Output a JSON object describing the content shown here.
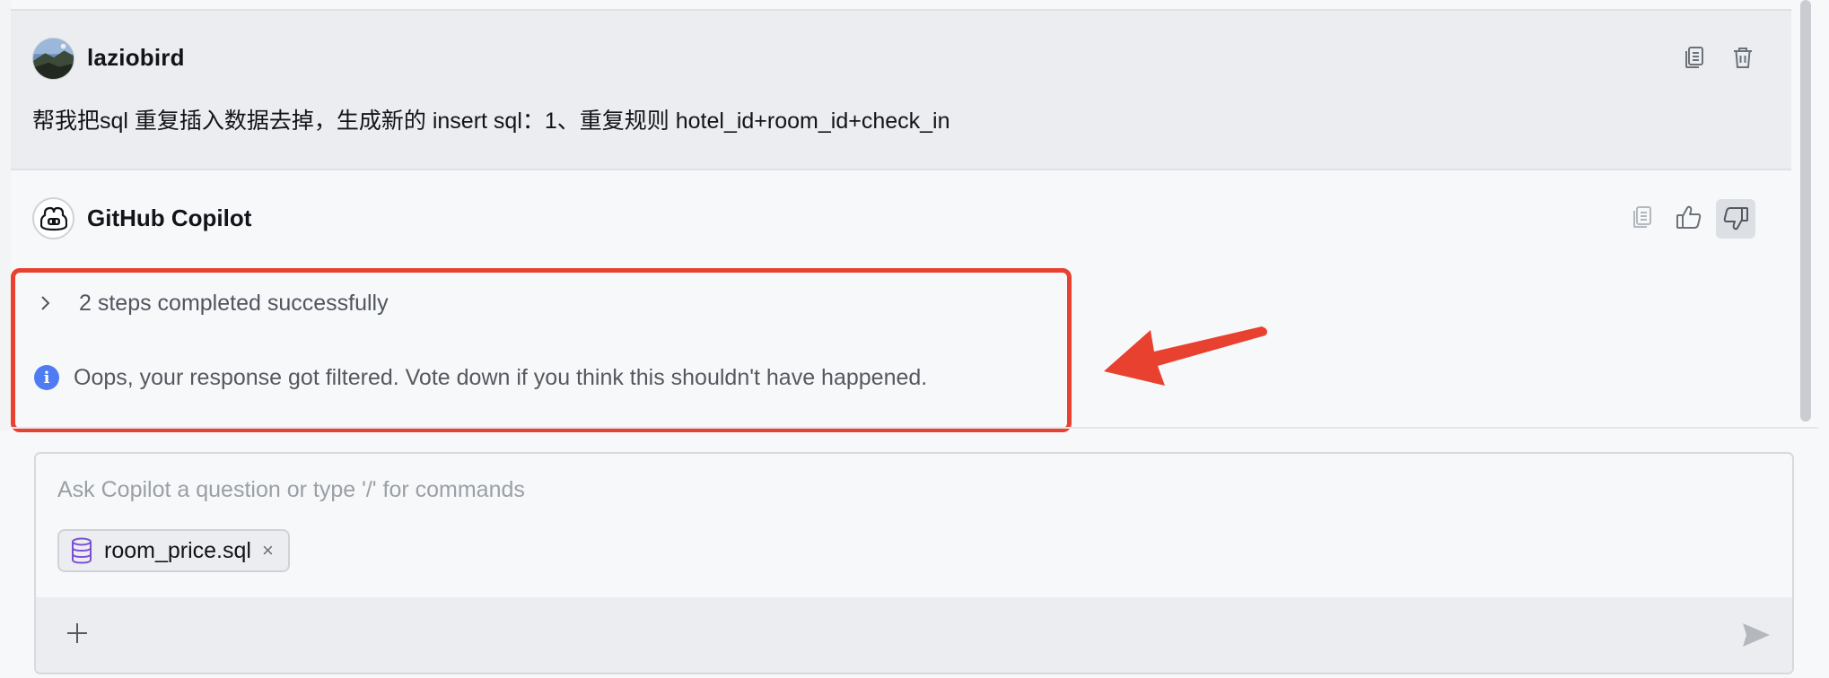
{
  "user_message": {
    "username": "laziobird",
    "text": "帮我把sql 重复插入数据去掉，生成新的 insert sql：1、重复规则 hotel_id+room_id+check_in",
    "actions": [
      "copy-icon",
      "trash-icon"
    ]
  },
  "assistant_message": {
    "name": "GitHub Copilot",
    "actions": [
      "copy-icon",
      "thumbs-up-icon",
      "thumbs-down-icon"
    ],
    "steps_label": "2 steps completed successfully",
    "info_text": "Oops, your response got filtered. Vote down if you think this shouldn't have happened."
  },
  "input": {
    "placeholder": "Ask Copilot a question or type '/' for commands",
    "attachment": {
      "filename": "room_price.sql",
      "icon": "database-icon",
      "close_glyph": "×"
    },
    "add_icon": "plus-icon",
    "send_icon": "send-icon"
  },
  "colors": {
    "highlight": "#e8412f",
    "info_icon": "#4f7cf2",
    "attachment_icon": "#7a4fd6"
  }
}
